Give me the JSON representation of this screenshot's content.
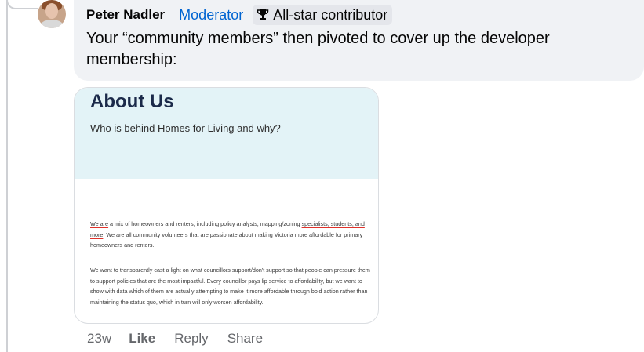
{
  "comment": {
    "author": "Peter Nadler",
    "role": "Moderator",
    "badge": {
      "icon": "trophy-icon",
      "label": "All-star contributor"
    },
    "text": "Your “community members” then pivoted to cover up the developer membership:"
  },
  "attachment": {
    "title": "About Us",
    "subtitle": "Who is behind Homes for Living and why?",
    "para1": {
      "u1": "We are",
      "t1": " a mix of homeowners and renters, including policy analysts, mapping/zoning ",
      "u2": "specialists, students, and more",
      "t2": ". We are all community volunteers that are passionate about making Victoria more affordable for primary homeowners and renters."
    },
    "para2": {
      "u1": "We want to transparently cast a light",
      "t1": " on what councillors support/don't support ",
      "u2": "so that people can pressure them",
      "t2": " to support policies that are the most impactful. Every ",
      "u3": "councillor pays lip service",
      "t3": " to affordability, but we want to show with data which of them are actually attempting to make it more affordable through bold action rather than maintaining the status quo, which in turn will only worsen affordability."
    }
  },
  "actions": {
    "time": "23w",
    "like": "Like",
    "reply": "Reply",
    "share": "Share"
  },
  "colors": {
    "role_link": "#0064d1",
    "underline": "#e0312a",
    "bubble_bg": "#f0f2f5"
  }
}
